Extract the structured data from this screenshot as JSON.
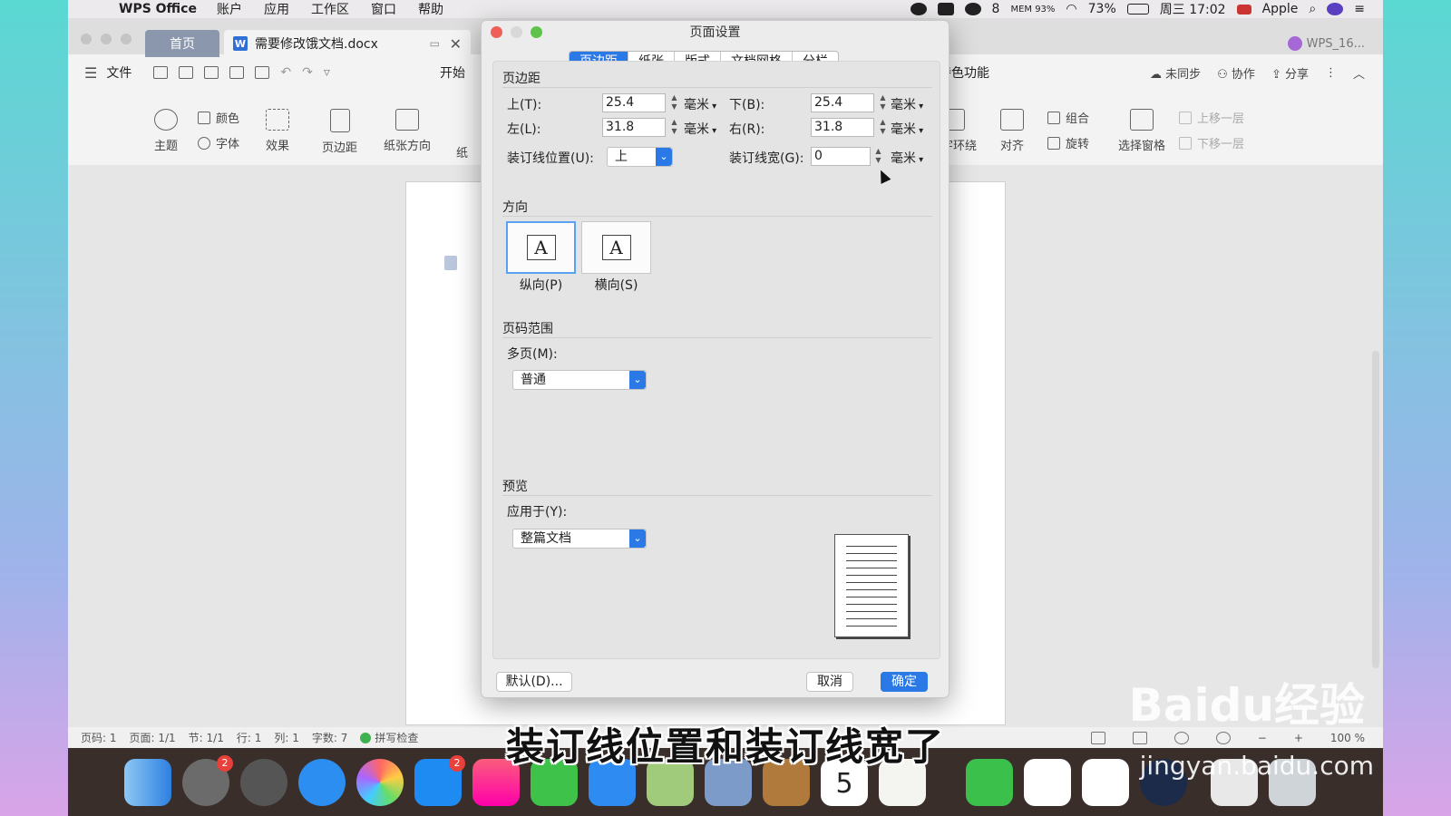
{
  "menubar": {
    "app": "WPS Office",
    "items": [
      "账户",
      "应用",
      "工作区",
      "窗口",
      "帮助"
    ],
    "status": {
      "wechat_count": "8",
      "mem": "MEM 93%",
      "battery": "73%",
      "clock": "周三 17:02",
      "user": "Apple"
    }
  },
  "window": {
    "home_tab": "首页",
    "doc_tab": "需要修改饿文档.docx",
    "user_tab": "WPS_16...",
    "file_menu": "文件",
    "start_tab": "开始",
    "feature_tab": "特色功能",
    "sync": "未同步",
    "collab": "协作",
    "share": "分享"
  },
  "ribbon": {
    "theme": "主题",
    "color": "颜色",
    "font": "字体",
    "effect": "效果",
    "margin": "页边距",
    "orientation": "纸张方向",
    "paper_cut": "纸",
    "wrap": "文字环绕",
    "align": "对齐",
    "group": "组合",
    "rotate": "旋转",
    "select_pane": "选择窗格",
    "bring_forward": "上移一层",
    "send_backward": "下移一层"
  },
  "statusbar": {
    "page_no": "页码: 1",
    "pages": "页面: 1/1",
    "section": "节: 1/1",
    "row": "行: 1",
    "col": "列: 1",
    "words": "字数: 7",
    "spell": "拼写检查",
    "zoom": "100 %"
  },
  "dialog": {
    "title": "页面设置",
    "tabs": [
      "页边距",
      "纸张",
      "版式",
      "文档网格",
      "分栏"
    ],
    "active_tab": "页边距",
    "margins_title": "页边距",
    "top_label": "上(T):",
    "top_value": "25.4",
    "bottom_label": "下(B):",
    "bottom_value": "25.4",
    "left_label": "左(L):",
    "left_value": "31.8",
    "right_label": "右(R):",
    "right_value": "31.8",
    "unit": "毫米",
    "gutter_pos_label": "装订线位置(U):",
    "gutter_pos_value": "上",
    "gutter_width_label": "装订线宽(G):",
    "gutter_width_value": "0",
    "orientation_title": "方向",
    "portrait": "纵向(P)",
    "landscape": "横向(S)",
    "orientation_glyph": "A",
    "page_range_title": "页码范围",
    "multi_page_label": "多页(M):",
    "multi_page_value": "普通",
    "preview_title": "预览",
    "apply_label": "应用于(Y):",
    "apply_value": "整篇文档",
    "default_button": "默认(D)...",
    "cancel_button": "取消",
    "ok_button": "确定"
  },
  "dock": {
    "settings_badge": "2",
    "appstore_badge": "2",
    "calendar_day": "5"
  },
  "subtitle": "装订线位置和装订线宽了",
  "watermark": {
    "brand": "Baidu经验",
    "url": "jingyan.baidu.com"
  },
  "colors": {
    "accent": "#2b79e6",
    "menubar": "#eceaec",
    "dock": "#3a2e2b"
  }
}
